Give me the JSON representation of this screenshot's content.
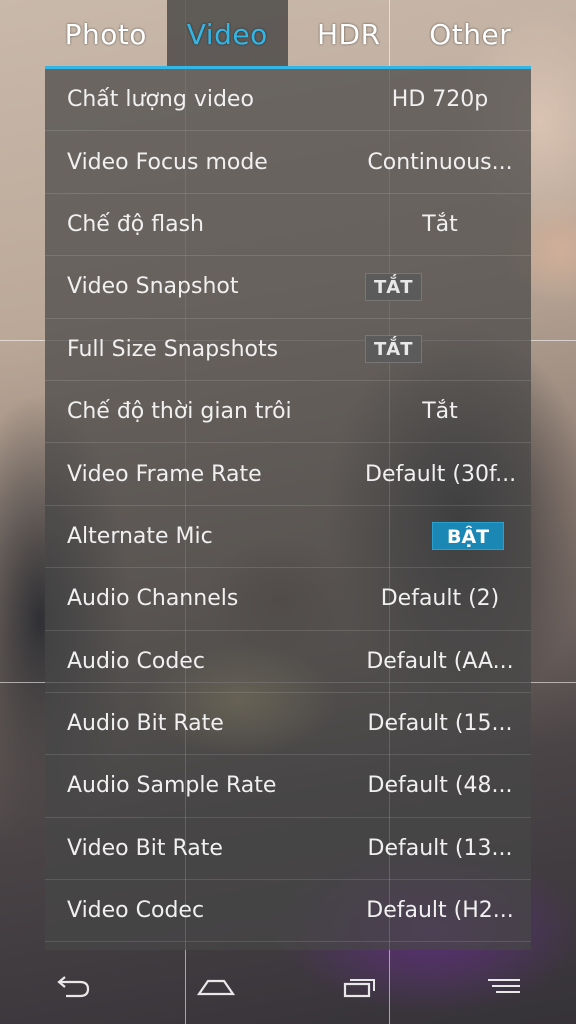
{
  "tabs": [
    {
      "label": "Photo",
      "active": false
    },
    {
      "label": "Video",
      "active": true
    },
    {
      "label": "HDR",
      "active": false
    },
    {
      "label": "Other",
      "active": false
    }
  ],
  "accent_color": "#33b5e5",
  "settings": [
    {
      "label": "Chất lượng video",
      "value": "HD 720p",
      "kind": "value"
    },
    {
      "label": "Video Focus mode",
      "value": "Continuous...",
      "kind": "value"
    },
    {
      "label": "Chế độ flash",
      "value": "Tắt",
      "kind": "value"
    },
    {
      "label": "Video Snapshot",
      "value": "TẮT",
      "kind": "toggle",
      "state": "off"
    },
    {
      "label": "Full Size Snapshots",
      "value": "TẮT",
      "kind": "toggle",
      "state": "off"
    },
    {
      "label": "Chế độ thời gian trôi",
      "value": "Tắt",
      "kind": "value"
    },
    {
      "label": "Video Frame Rate",
      "value": "Default (30f...",
      "kind": "value"
    },
    {
      "label": "Alternate Mic",
      "value": "BẬT",
      "kind": "toggle",
      "state": "on"
    },
    {
      "label": "Audio Channels",
      "value": "Default (2)",
      "kind": "value"
    },
    {
      "label": "Audio Codec",
      "value": "Default (AA...",
      "kind": "value"
    },
    {
      "label": "Audio Bit Rate",
      "value": "Default (15...",
      "kind": "value"
    },
    {
      "label": "Audio Sample Rate",
      "value": "Default (48...",
      "kind": "value"
    },
    {
      "label": "Video Bit Rate",
      "value": "Default (13...",
      "kind": "value"
    },
    {
      "label": "Video Codec",
      "value": "Default (H2...",
      "kind": "value"
    }
  ],
  "navbar": {
    "icons": [
      "back-icon",
      "home-icon",
      "recent-apps-icon",
      "menu-icon"
    ]
  }
}
